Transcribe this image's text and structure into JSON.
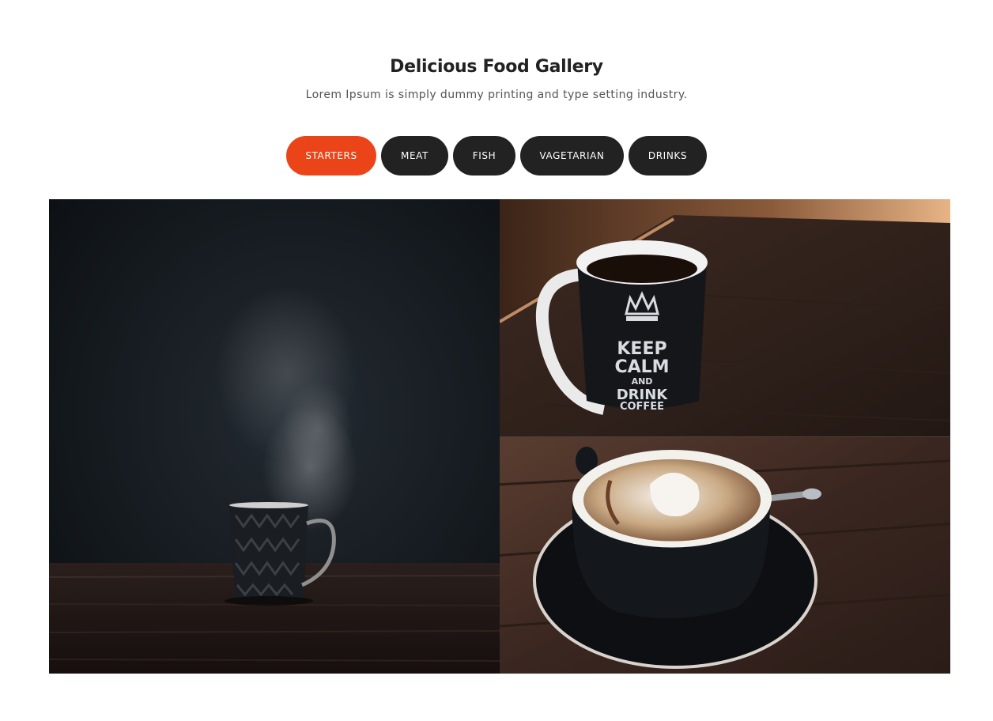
{
  "header": {
    "title": "Delicious Food Gallery",
    "subtitle": "Lorem Ipsum is simply dummy printing and type setting industry."
  },
  "filters": [
    {
      "label": "STARTERS",
      "active": true
    },
    {
      "label": "MEAT",
      "active": false
    },
    {
      "label": "FISH",
      "active": false
    },
    {
      "label": "VAGETARIAN",
      "active": false
    },
    {
      "label": "DRINKS",
      "active": false
    }
  ],
  "gallery": {
    "images": [
      {
        "subject": "steaming black mug on dark wooden table"
      },
      {
        "subject": "keep calm and drink coffee mug on wooden table",
        "mug_text": [
          "KEEP",
          "CALM",
          "AND",
          "DRINK",
          "COFFEE"
        ]
      },
      {
        "subject": "coffee cup with cream on black saucer"
      }
    ]
  },
  "colors": {
    "accent": "#ec4419",
    "button_dark": "#222222",
    "title": "#222222",
    "subtitle": "#555555"
  }
}
